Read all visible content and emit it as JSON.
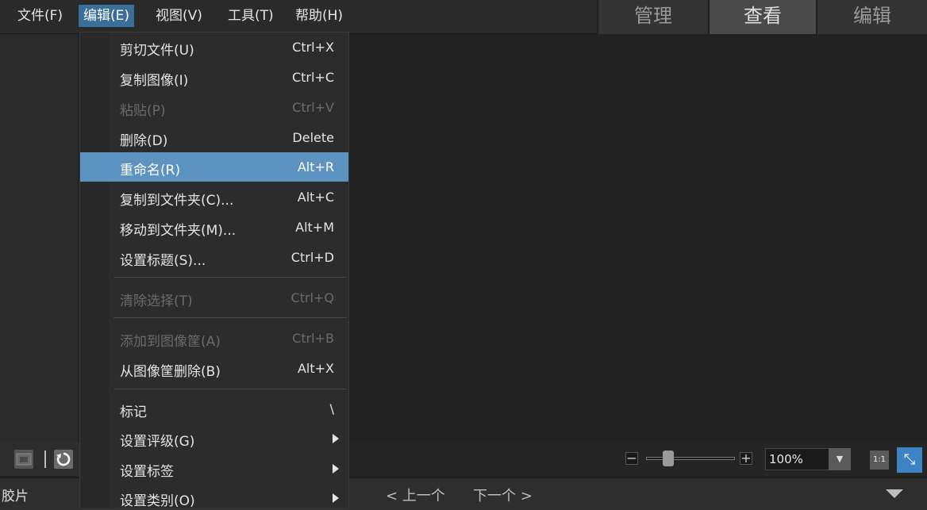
{
  "menubar": {
    "items": [
      {
        "label": "文件(F)"
      },
      {
        "label": "编辑(E)"
      },
      {
        "label": "视图(V)"
      },
      {
        "label": "工具(T)"
      },
      {
        "label": "帮助(H)"
      }
    ],
    "active_index": 1
  },
  "mode_tabs": [
    {
      "label": "管理"
    },
    {
      "label": "查看"
    },
    {
      "label": "编辑"
    }
  ],
  "edit_menu": {
    "items": [
      {
        "label": "剪切文件(U)",
        "shortcut": "Ctrl+X"
      },
      {
        "label": "复制图像(I)",
        "shortcut": "Ctrl+C"
      },
      {
        "label": "粘贴(P)",
        "shortcut": "Ctrl+V"
      },
      {
        "label": "删除(D)",
        "shortcut": "Delete"
      },
      {
        "label": "重命名(R)",
        "shortcut": "Alt+R"
      },
      {
        "label": "复制到文件夹(C)...",
        "shortcut": "Alt+C"
      },
      {
        "label": "移动到文件夹(M)...",
        "shortcut": "Alt+M"
      },
      {
        "label": "设置标题(S)...",
        "shortcut": "Ctrl+D"
      },
      {
        "label": "清除选择(T)",
        "shortcut": "Ctrl+Q"
      },
      {
        "label": "添加到图像筐(A)",
        "shortcut": "Ctrl+B"
      },
      {
        "label": "从图像筐删除(B)",
        "shortcut": "Alt+X"
      },
      {
        "label": "标记",
        "shortcut": "\\"
      },
      {
        "label": "设置评级(G)",
        "shortcut": ""
      },
      {
        "label": "设置标签",
        "shortcut": ""
      },
      {
        "label": "设置类别(O)",
        "shortcut": ""
      }
    ]
  },
  "zoom": {
    "minus": "−",
    "plus": "+",
    "value": "100%",
    "level": 0.25
  },
  "status_bar": {
    "film_label": "胶片",
    "prev_label": "< 上一个",
    "next_label": "下一个 >"
  },
  "colors": {
    "highlight": "#5d93c1",
    "menubar_active": "#3b6e99",
    "fullscreen_button": "#3e84c4"
  }
}
